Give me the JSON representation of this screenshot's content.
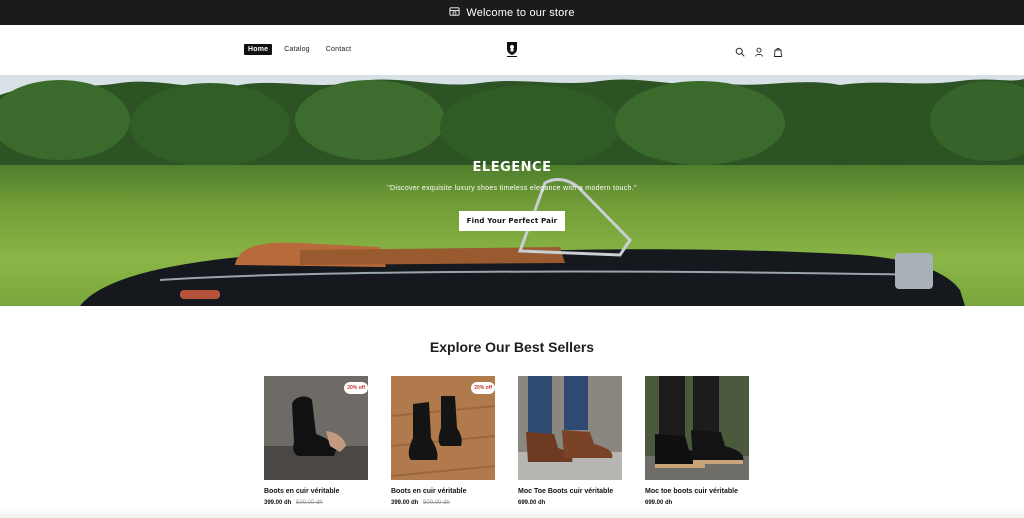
{
  "announcement": {
    "text": "Welcome to our store",
    "icon": "store-icon"
  },
  "header": {
    "nav": [
      {
        "label": "Home",
        "active": true
      },
      {
        "label": "Catalog",
        "active": false
      },
      {
        "label": "Contact",
        "active": false
      }
    ],
    "logo": "shield-logo",
    "icons": [
      "search-icon",
      "account-icon",
      "cart-icon"
    ]
  },
  "hero": {
    "title": "ELEGENCE",
    "subtitle": "\"Discover exquisite luxury shoes timeless elegance with a modern touch.\"",
    "button_label": "Find Your Perfect Pair"
  },
  "best_sellers": {
    "title": "Explore Our Best Sellers",
    "products": [
      {
        "name": "Boots en cuir véritable",
        "price": "399.00 dh",
        "compare_price": "500.00 dh",
        "badge": "20% off"
      },
      {
        "name": "Boots en cuir véritable",
        "price": "399.00 dh",
        "compare_price": "500.00 dh",
        "badge": "20% off"
      },
      {
        "name": "Moc Toe Boots cuir véritable",
        "price": "699.00 dh",
        "compare_price": "",
        "badge": ""
      },
      {
        "name": "Moc toe boots cuir véritable",
        "price": "699.00 dh",
        "compare_price": "",
        "badge": ""
      }
    ]
  },
  "colors": {
    "announcement_bg": "#1b1b1b",
    "badge_text": "#c0392b",
    "accent": "#111111"
  }
}
